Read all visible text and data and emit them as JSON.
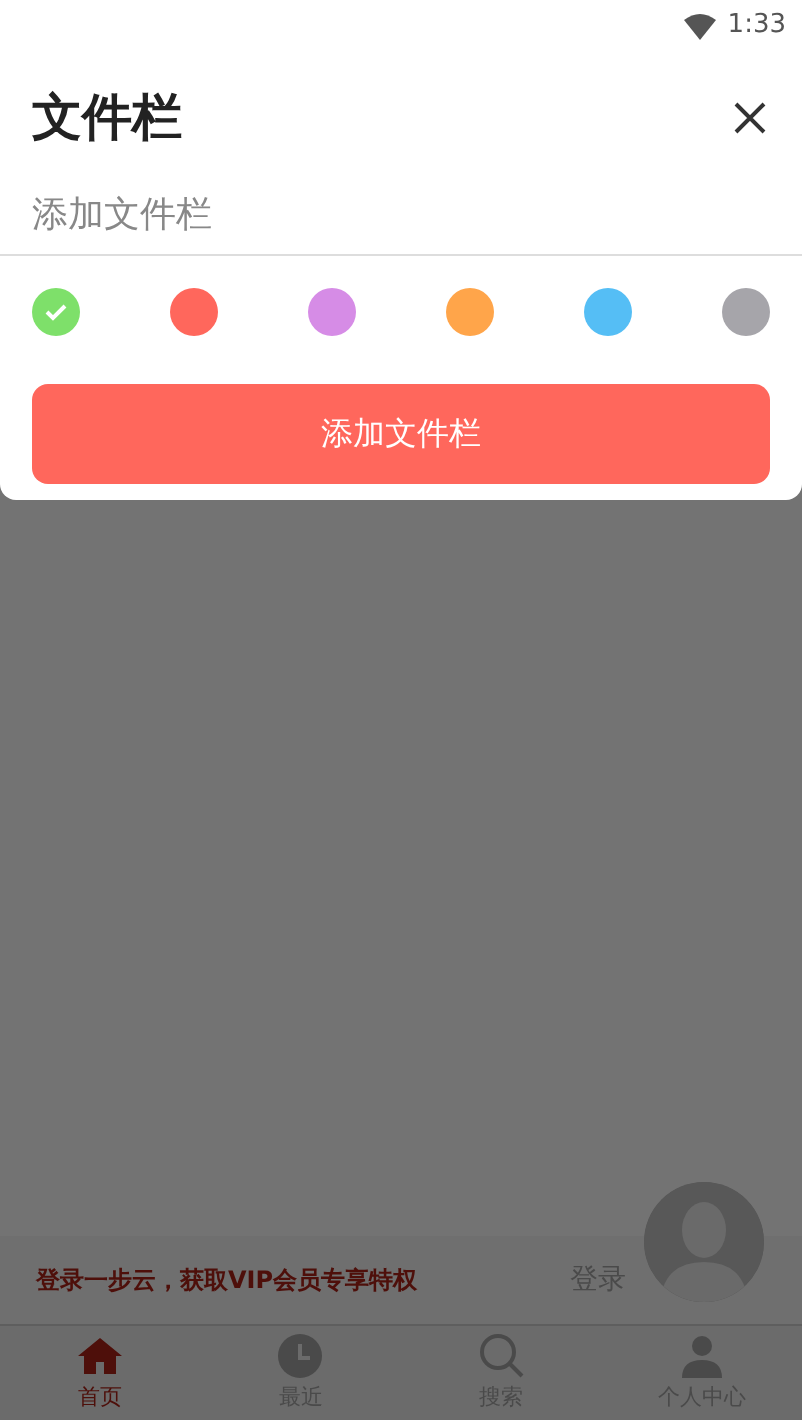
{
  "status_bar": {
    "time": "1:33"
  },
  "sheet": {
    "title": "文件栏",
    "input": {
      "placeholder": "添加文件栏"
    },
    "colors": [
      {
        "color": "#7ee06a",
        "selected": true
      },
      {
        "color": "#ff675c",
        "selected": false
      },
      {
        "color": "#d68ce6",
        "selected": false
      },
      {
        "color": "#ffa54a",
        "selected": false
      },
      {
        "color": "#55bef5",
        "selected": false
      },
      {
        "color": "#a6a5aa",
        "selected": false
      }
    ],
    "button": "添加文件栏"
  },
  "banner": {
    "text": "登录一步云，获取VIP会员专享特权",
    "login": "登录"
  },
  "tabs": [
    {
      "label": "首页",
      "kind": "home",
      "selected": true
    },
    {
      "label": "最近",
      "kind": "recent",
      "selected": false
    },
    {
      "label": "搜索",
      "kind": "search",
      "selected": false
    },
    {
      "label": "个人中心",
      "kind": "profile",
      "selected": false
    }
  ]
}
